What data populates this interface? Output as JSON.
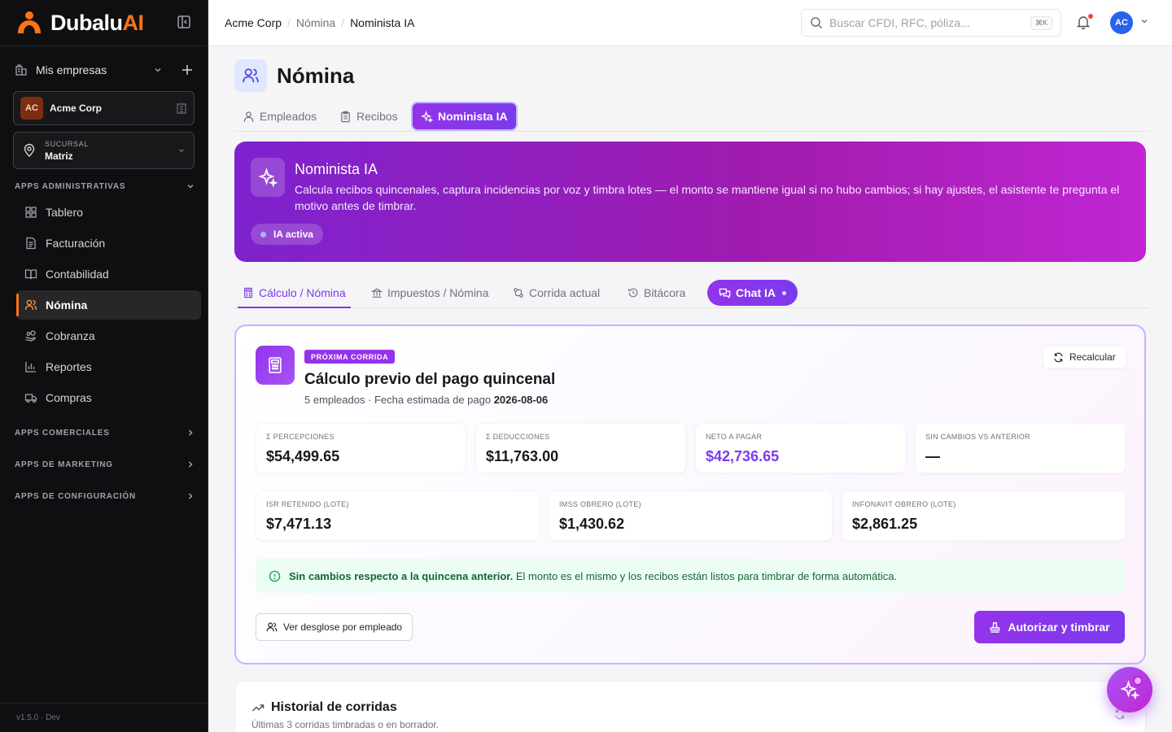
{
  "brand": {
    "name": "Dubalu",
    "suffix": "AI"
  },
  "sidebar": {
    "mis_empresas": "Mis empresas",
    "company": {
      "initials": "AC",
      "name": "Acme Corp"
    },
    "branch": {
      "label": "SUCURSAL",
      "value": "Matriz"
    },
    "sections": {
      "admin": "APPS ADMINISTRATIVAS",
      "comerciales": "APPS COMERCIALES",
      "marketing": "APPS DE MARKETING",
      "config": "APPS DE CONFIGURACIÓN"
    },
    "items": [
      {
        "label": "Tablero",
        "icon": "grid-icon"
      },
      {
        "label": "Facturación",
        "icon": "document-icon"
      },
      {
        "label": "Contabilidad",
        "icon": "book-icon"
      },
      {
        "label": "Nómina",
        "icon": "users-icon",
        "active": true
      },
      {
        "label": "Cobranza",
        "icon": "hand-coins-icon"
      },
      {
        "label": "Reportes",
        "icon": "bar-chart-icon"
      },
      {
        "label": "Compras",
        "icon": "truck-icon"
      }
    ],
    "version": "v1.5.0 · Dev"
  },
  "topbar": {
    "breadcrumb": [
      "Acme Corp",
      "Nómina",
      "Nominista IA"
    ],
    "search_placeholder": "Buscar CFDI, RFC, póliza...",
    "search_shortcut": "⌘K",
    "user_initials": "AC"
  },
  "page": {
    "title": "Nómina",
    "tabs": [
      {
        "label": "Empleados"
      },
      {
        "label": "Recibos"
      },
      {
        "label": "Nominista IA",
        "active": true
      }
    ]
  },
  "hero": {
    "title": "Nominista IA",
    "description": "Calcula recibos quincenales, captura incidencias por voz y timbra lotes — el monto se mantiene igual si no hubo cambios; si hay ajustes, el asistente te pregunta el motivo antes de timbrar.",
    "pill": "IA activa"
  },
  "sub_tabs": [
    {
      "label": "Cálculo / Nómina",
      "active": true
    },
    {
      "label": "Impuestos / Nómina"
    },
    {
      "label": "Corrida actual"
    },
    {
      "label": "Bitácora"
    },
    {
      "label": "Chat IA"
    }
  ],
  "calc": {
    "badge": "PRÓXIMA CORRIDA",
    "title": "Cálculo previo del pago quincenal",
    "subtitle_prefix": "5 empleados · Fecha estimada de pago ",
    "pay_date": "2026-08-06",
    "recalc": "Recalcular",
    "stats_row1": [
      {
        "label": "Σ PERCEPCIONES",
        "value": "$54,499.65"
      },
      {
        "label": "Σ DEDUCCIONES",
        "value": "$11,763.00"
      },
      {
        "label": "NETO A PAGAR",
        "value": "$42,736.65"
      },
      {
        "label": "SIN CAMBIOS VS ANTERIOR",
        "value": "—"
      }
    ],
    "stats_row2": [
      {
        "label": "ISR RETENIDO (LOTE)",
        "value": "$7,471.13"
      },
      {
        "label": "IMSS OBRERO (LOTE)",
        "value": "$1,430.62"
      },
      {
        "label": "INFONAVIT OBRERO (LOTE)",
        "value": "$2,861.25"
      }
    ],
    "notice_bold": "Sin cambios respecto a la quincena anterior.",
    "notice_rest": " El monto es el mismo y los recibos están listos para timbrar de forma automática.",
    "btn_breakdown": "Ver desglose por empleado",
    "btn_authorize": "Autorizar y timbrar"
  },
  "history": {
    "title": "Historial de corridas",
    "subtitle": "Últimas 3 corridas timbradas o en borrador."
  },
  "colors": {
    "accent": "#7c3aed",
    "brand_orange": "#f97316",
    "success_bg": "#ecfdf3"
  }
}
